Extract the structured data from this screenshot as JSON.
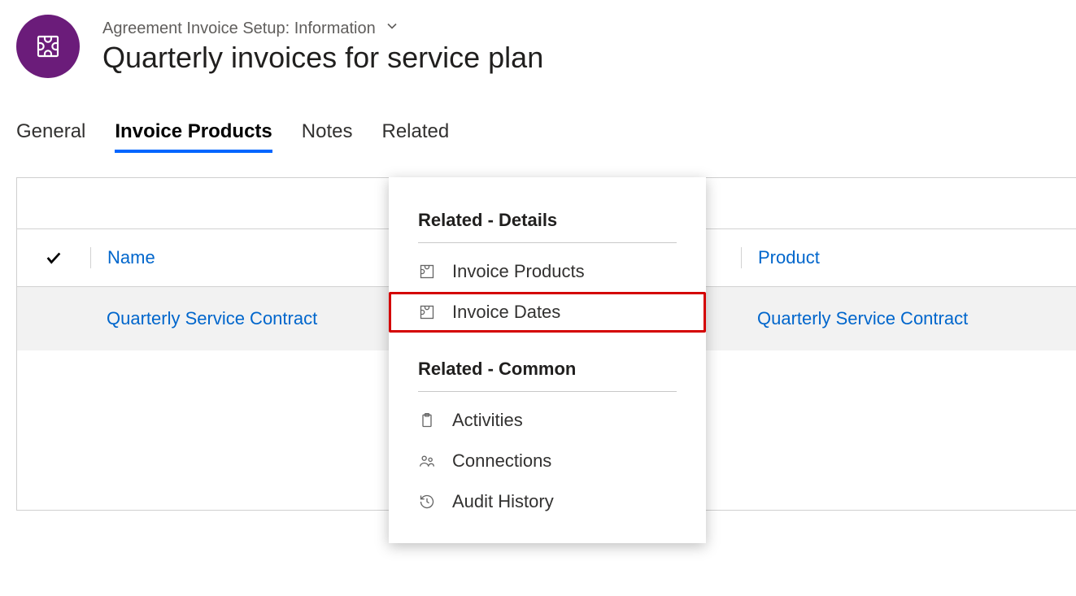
{
  "header": {
    "breadcrumb": "Agreement Invoice Setup: Information",
    "title": "Quarterly invoices for service plan"
  },
  "tabs": [
    {
      "label": "General",
      "active": false
    },
    {
      "label": "Invoice Products",
      "active": true
    },
    {
      "label": "Notes",
      "active": false
    },
    {
      "label": "Related",
      "active": false
    }
  ],
  "table": {
    "headers": {
      "name": "Name",
      "product": "Product"
    },
    "rows": [
      {
        "name": "Quarterly Service Contract",
        "product": "Quarterly Service Contract"
      }
    ]
  },
  "dropdown": {
    "section1_title": "Related - Details",
    "section1_items": [
      {
        "label": "Invoice Products",
        "icon": "puzzle"
      },
      {
        "label": "Invoice Dates",
        "icon": "puzzle",
        "highlight": true
      }
    ],
    "section2_title": "Related - Common",
    "section2_items": [
      {
        "label": "Activities",
        "icon": "clipboard"
      },
      {
        "label": "Connections",
        "icon": "people"
      },
      {
        "label": "Audit History",
        "icon": "history"
      }
    ]
  }
}
